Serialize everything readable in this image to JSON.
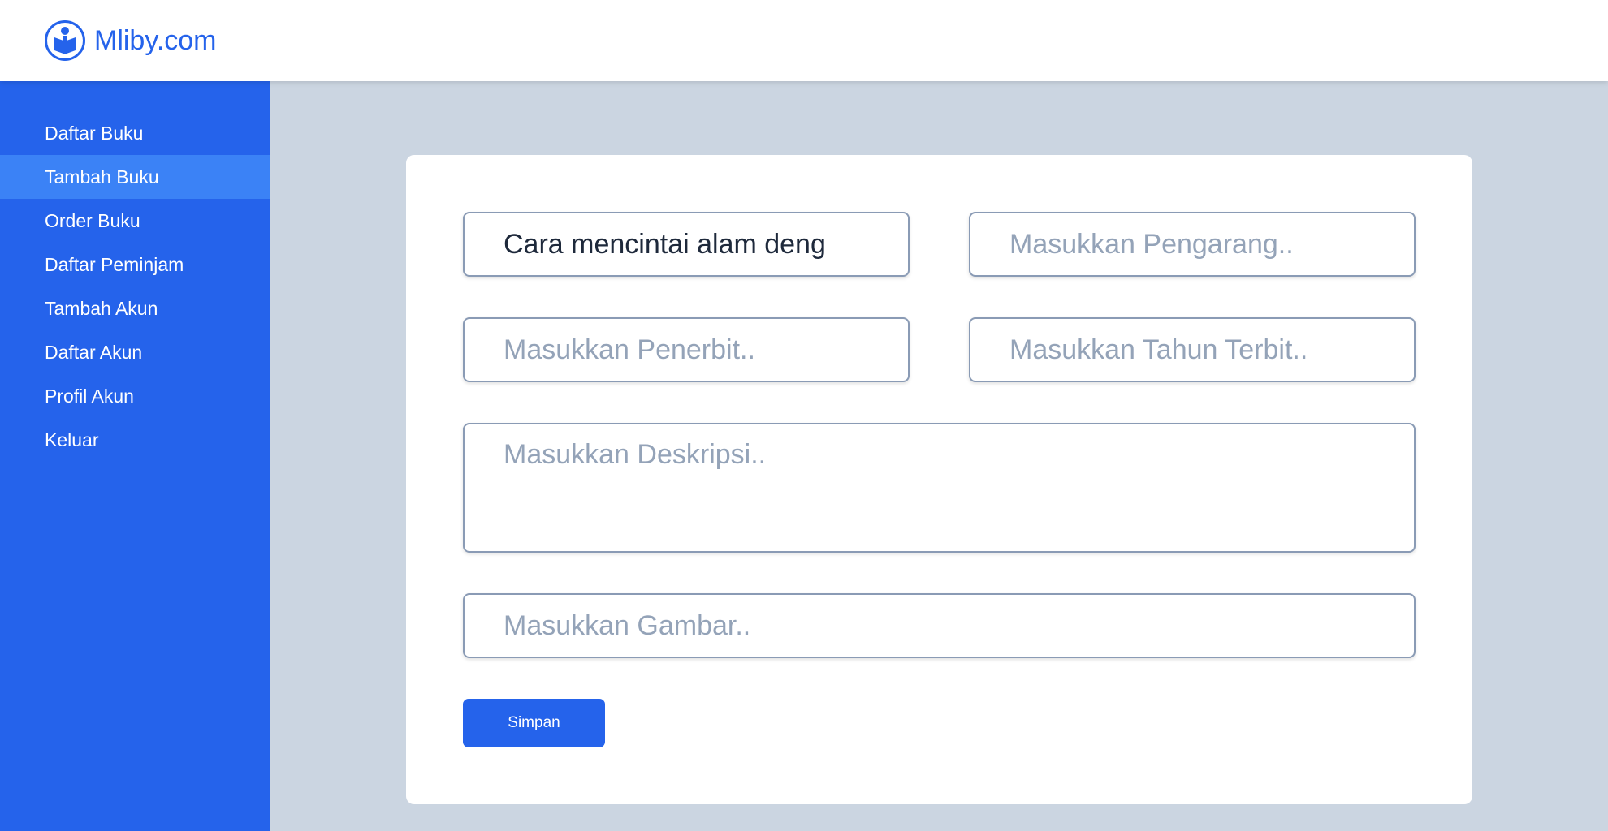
{
  "brand": {
    "name": "Mliby.com",
    "logo_icon": "reader-icon",
    "color": "#2563eb"
  },
  "sidebar": {
    "items": [
      {
        "label": "Daftar Buku",
        "active": false
      },
      {
        "label": "Tambah Buku",
        "active": true
      },
      {
        "label": "Order Buku",
        "active": false
      },
      {
        "label": "Daftar Peminjam",
        "active": false
      },
      {
        "label": "Tambah Akun",
        "active": false
      },
      {
        "label": "Daftar Akun",
        "active": false
      },
      {
        "label": "Profil Akun",
        "active": false
      },
      {
        "label": "Keluar",
        "active": false
      }
    ]
  },
  "form": {
    "title_value": "Cara mencintai alam deng",
    "author_placeholder": "Masukkan Pengarang..",
    "publisher_placeholder": "Masukkan Penerbit..",
    "year_placeholder": "Masukkan Tahun Terbit..",
    "description_placeholder": "Masukkan Deskripsi..",
    "image_placeholder": "Masukkan Gambar..",
    "submit_label": "Simpan"
  },
  "colors": {
    "primary": "#2563eb",
    "active_nav": "#3b82f6",
    "background": "#cbd5e1"
  }
}
